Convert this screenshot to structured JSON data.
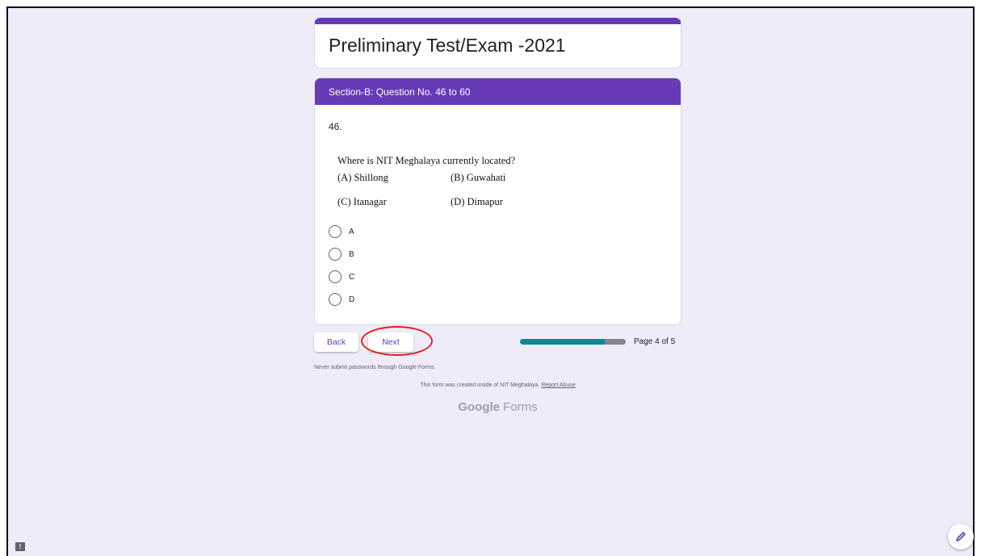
{
  "form": {
    "title": "Preliminary Test/Exam -2021",
    "accent_color": "#673ab7"
  },
  "section": {
    "header": "Section-B: Question No. 46 to 60"
  },
  "question": {
    "number": "46.",
    "text": "Where is NIT Meghalaya currently located?",
    "image_options": [
      {
        "label": "(A) Shillong"
      },
      {
        "label": "(B) Guwahati"
      },
      {
        "label": "(C) Itanagar"
      },
      {
        "label": "(D) Dimapur"
      }
    ],
    "choices": [
      {
        "label": "A"
      },
      {
        "label": "B"
      },
      {
        "label": "C"
      },
      {
        "label": "D"
      }
    ]
  },
  "navigation": {
    "back_label": "Back",
    "next_label": "Next",
    "progress_fraction": 0.8,
    "page_indicator": "Page 4 of 5"
  },
  "footer": {
    "warning": "Never submit passwords through Google Forms.",
    "created_text": "This form was created inside of NIT Meghalaya.",
    "report_link": "Report Abuse",
    "brand_google": "Google",
    "brand_forms": "Forms"
  },
  "annotation": {
    "highlight_color": "#e0201f"
  },
  "icons": {
    "report": "report-icon",
    "edit": "pencil-icon"
  }
}
